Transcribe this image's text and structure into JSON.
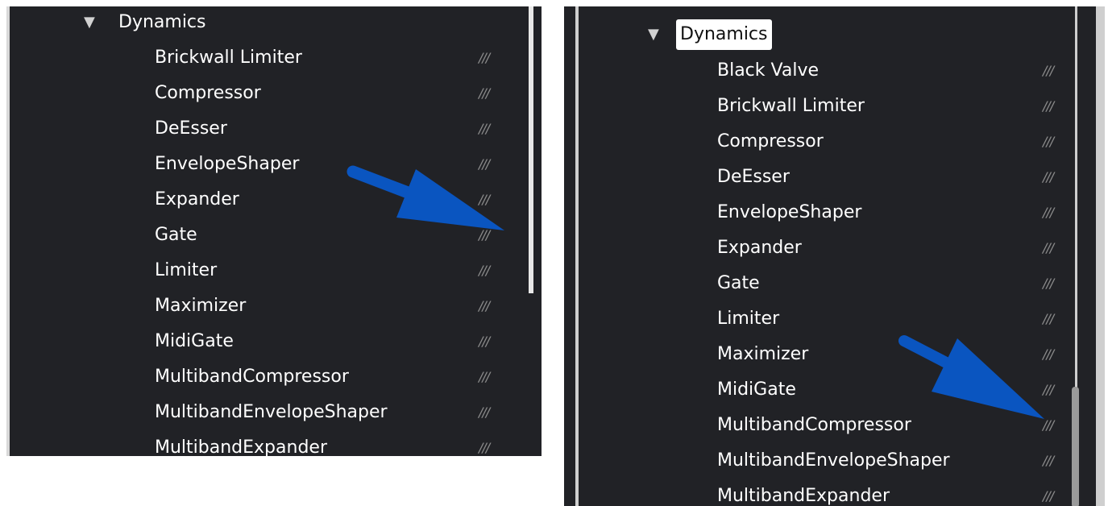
{
  "colors": {
    "panel_background": "#212226",
    "text": "#ffffff",
    "grip": "#8c8c8c",
    "arrow": "#0a55c0",
    "header_highlight": "#ffffff"
  },
  "panels": [
    {
      "category": "Dynamics",
      "category_selected": false,
      "items": [
        {
          "label": "Brickwall Limiter",
          "grip": "///"
        },
        {
          "label": "Compressor",
          "grip": "///"
        },
        {
          "label": "DeEsser",
          "grip": "///"
        },
        {
          "label": "EnvelopeShaper",
          "grip": "///"
        },
        {
          "label": "Expander",
          "grip": "///"
        },
        {
          "label": "Gate",
          "grip": "///"
        },
        {
          "label": "Limiter",
          "grip": "///"
        },
        {
          "label": "Maximizer",
          "grip": "///"
        },
        {
          "label": "MidiGate",
          "grip": "///"
        },
        {
          "label": "MultibandCompressor",
          "grip": "///"
        },
        {
          "label": "MultibandEnvelopeShaper",
          "grip": "///"
        },
        {
          "label": "MultibandExpander",
          "grip": "///"
        }
      ],
      "arrow_icon": "blue-arrow-icon"
    },
    {
      "category": "Dynamics",
      "category_selected": true,
      "items": [
        {
          "label": "Black Valve",
          "grip": "///"
        },
        {
          "label": "Brickwall Limiter",
          "grip": "///"
        },
        {
          "label": "Compressor",
          "grip": "///"
        },
        {
          "label": "DeEsser",
          "grip": "///"
        },
        {
          "label": "EnvelopeShaper",
          "grip": "///"
        },
        {
          "label": "Expander",
          "grip": "///"
        },
        {
          "label": "Gate",
          "grip": "///"
        },
        {
          "label": "Limiter",
          "grip": "///"
        },
        {
          "label": "Maximizer",
          "grip": "///"
        },
        {
          "label": "MidiGate",
          "grip": "///"
        },
        {
          "label": "MultibandCompressor",
          "grip": "///"
        },
        {
          "label": "MultibandEnvelopeShaper",
          "grip": "///"
        },
        {
          "label": "MultibandExpander",
          "grip": "///"
        }
      ],
      "arrow_icon": "blue-arrow-icon"
    }
  ]
}
